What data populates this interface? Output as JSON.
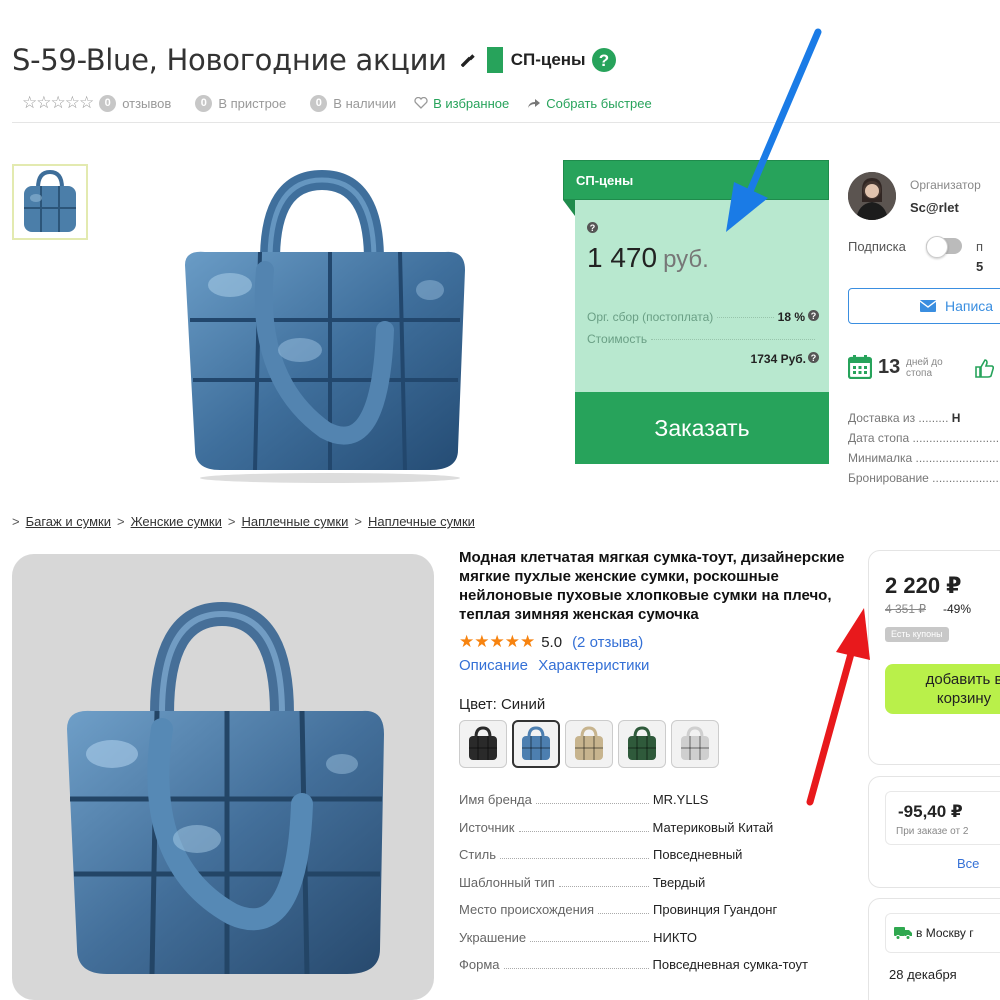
{
  "header": {
    "title": "S-59-Blue, Новогодние акции",
    "sp_badge": "СП-цены",
    "rating_stars": "☆☆☆☆☆",
    "reviews_count": "0",
    "reviews_label": "отзывов",
    "attach_count": "0",
    "attach_label": "В пристрое",
    "stock_count": "0",
    "stock_label": "В наличии",
    "favorites": "В избранное",
    "collect": "Собрать быстрее"
  },
  "price_box": {
    "header": "СП-цены",
    "price": "1 470",
    "currency": "руб.",
    "fee_label": "Орг. сбор (постоплата)",
    "fee_value": "18 %",
    "cost_label": "Стоимость",
    "cost_value": "1734 Руб.",
    "order_button": "Заказать"
  },
  "organizer": {
    "role": "Организатор",
    "name": "Sc@rlet",
    "subscription": "Подписка",
    "sub_p": "п",
    "sub_count": "5",
    "write_button": "Написа",
    "days_count": "13",
    "days_label_1": "дней до",
    "days_label_2": "стопа",
    "delivery_from": "Доставка из",
    "delivery_from_value": "Н",
    "stop_date": "Дата стопа",
    "minimum": "Минималка",
    "booking": "Бронирование"
  },
  "breadcrumb": [
    "Багаж и сумки",
    "Женские сумки",
    "Наплечные сумки",
    "Наплечные сумки"
  ],
  "product": {
    "title": "Модная клетчатая мягкая сумка-тоут, дизайнерские мягкие пухлые женские сумки, роскошные нейлоновые пуховые хлопковые сумки на плечо, теплая зимняя женская сумочка",
    "stars": "★★★★★",
    "score": "5.0",
    "reviews": "(2 отзыва)",
    "tab_description": "Описание",
    "tab_specs": "Характеристики",
    "color_label": "Цвет: Синий",
    "swatch_colors": [
      "#2a2a2a",
      "#4d7fb0",
      "#c7b48e",
      "#2f5a3b",
      "#cfcfcf"
    ],
    "specs": [
      {
        "k": "Имя бренда",
        "v": "MR.YLLS"
      },
      {
        "k": "Источник",
        "v": "Материковый Китай"
      },
      {
        "k": "Стиль",
        "v": "Повседневный"
      },
      {
        "k": "Шаблонный тип",
        "v": "Твердый"
      },
      {
        "k": "Место происхождения",
        "v": "Провинция Гуандонг"
      },
      {
        "k": "Украшение",
        "v": "НИКТО"
      },
      {
        "k": "Форма",
        "v": "Повседневная сумка-тоут"
      }
    ]
  },
  "purchase": {
    "price": "2 220 ₽",
    "old_price": "4 351 ₽",
    "discount": "-49%",
    "coupon_badge": "Есть купоны",
    "add_to_cart": "добавить в корзину",
    "coupon_value": "-95,40 ₽",
    "coupon_condition": "При заказе от 2",
    "coupons_all": "Все",
    "delivery_to": "в Москву г",
    "delivery_date": "28 декабря"
  },
  "colors": {
    "sp_green": "#27a35b",
    "sp_light_green": "#b8e8cf",
    "ali_green": "#b9f04a",
    "ali_link": "#3470d6",
    "arrow_blue": "#1a7be6",
    "arrow_red": "#e8191c"
  }
}
